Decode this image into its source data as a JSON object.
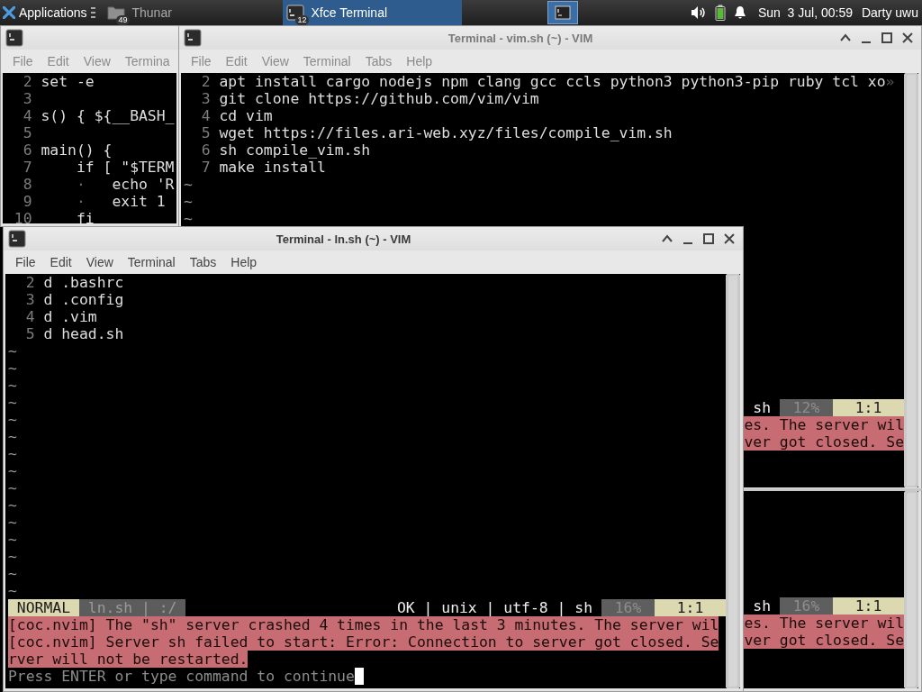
{
  "panel": {
    "menu_label": "Applications",
    "tasks": [
      {
        "kind": "files",
        "label": "Thunar",
        "badge": "49",
        "selected": false
      },
      {
        "kind": "terminal",
        "label": "Xfce Terminal",
        "badge": "12",
        "selected": true
      }
    ],
    "clock": "Sun  3 Jul, 00:59",
    "user": "Darty uwu"
  },
  "windows": [
    {
      "active": false,
      "menu": [
        "File",
        "Edit",
        "View",
        "Termina"
      ],
      "lines": [
        {
          "num": "2",
          "text": "set -e"
        },
        {
          "num": "3"
        },
        {
          "num": "4",
          "text": "s() { ${__BASH_"
        },
        {
          "num": "5"
        },
        {
          "num": "6",
          "text": "main() {"
        },
        {
          "num": "7",
          "text": "    if [ \"$TERM"
        },
        {
          "num": "8",
          "guide": "·",
          "text": "echo 'R"
        },
        {
          "num": "9",
          "guide": "·",
          "text": "exit 1"
        },
        {
          "num": "10",
          "text": "    fi"
        }
      ]
    },
    {
      "active": false,
      "title": "Terminal - vim.sh (~) - VIM",
      "menu": [
        "File",
        "Edit",
        "View",
        "Terminal",
        "Tabs",
        "Help"
      ],
      "lines": [
        {
          "num": "2",
          "text": "apt install cargo nodejs npm clang gcc ccls python3 python3-pip ruby tcl xo",
          "overflow": "»"
        },
        {
          "num": "3",
          "text": "git clone https://github.com/vim/vim"
        },
        {
          "num": "4",
          "text": "cd vim"
        },
        {
          "num": "5",
          "text": "wget https://files.ari-web.xyz/files/compile_vim.sh"
        },
        {
          "num": "6",
          "text": "sh compile_vim.sh"
        },
        {
          "num": "7",
          "text": "make install"
        }
      ],
      "empty_lines": [
        "~",
        "~",
        "~"
      ],
      "status": [
        {
          "kind": "info",
          "text": "sh"
        },
        {
          "kind": "percent",
          "text": "12%"
        },
        {
          "kind": "position",
          "text": "1:1"
        }
      ],
      "messages": [
        "es. The server wil",
        "ver got closed. Se"
      ]
    },
    {
      "active": true,
      "title": "Terminal - ln.sh (~) - VIM",
      "menu": [
        "File",
        "Edit",
        "View",
        "Terminal",
        "Tabs",
        "Help"
      ],
      "lines": [
        {
          "num": "2",
          "text": "d .bashrc"
        },
        {
          "num": "3",
          "text": "d .config"
        },
        {
          "num": "4",
          "text": "d .vim"
        },
        {
          "num": "5",
          "text": "d head.sh"
        }
      ],
      "empty_lines": [
        "~",
        "~",
        "~",
        "~",
        "~",
        "~",
        "~",
        "~",
        "~",
        "~",
        "~",
        "~",
        "~",
        "~",
        "~"
      ],
      "status": [
        {
          "kind": "mode",
          "text": "NORMAL"
        },
        {
          "kind": "file",
          "text": "ln.sh | :/"
        },
        {
          "kind": "info",
          "text": "OK | unix | utf-8 | sh"
        },
        {
          "kind": "percent",
          "text": "16%"
        },
        {
          "kind": "position",
          "text": "1:1"
        }
      ],
      "messages": [
        "[coc.nvim] The \"sh\" server crashed 4 times in the last 3 minutes. The server wil",
        "[coc.nvim] Server sh failed to start: Error: Connection to server got closed. Se",
        "rver will not be restarted."
      ],
      "prompt": "Press ENTER or type command to continue"
    },
    {
      "status": [
        {
          "kind": "info",
          "text": "sh"
        },
        {
          "kind": "percent",
          "text": "16%"
        },
        {
          "kind": "position",
          "text": "1:1"
        }
      ],
      "messages": [
        "es. The server wil",
        "ver got closed. Se"
      ]
    }
  ]
}
